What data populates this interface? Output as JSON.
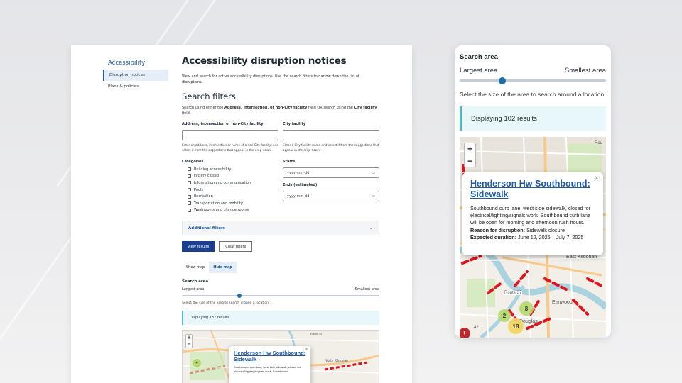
{
  "desktop": {
    "sidebar": {
      "title": "Accessibility",
      "items": [
        {
          "label": "Disruption notices",
          "active": true
        },
        {
          "label": "Plans & policies",
          "active": false
        }
      ]
    },
    "page_title": "Accessibility disruption notices",
    "intro": "View and search for active accessibility disruptions. Use the search filters to narrow down the list of disruptions.",
    "filters_heading": "Search filters",
    "filters_help_pre": "Search using either the ",
    "filters_help_b1": "Address, intersection, or non-City facility",
    "filters_help_mid": " field OR search using the ",
    "filters_help_b2": "City facility",
    "filters_help_post": " field.",
    "address": {
      "label": "Address, intersection or non-City facility",
      "value": "",
      "help": "Enter an address, intersection or name of a non-City facility, and select if from the suggestions that appear in the drop-down."
    },
    "facility": {
      "label": "City facility",
      "value": "",
      "help": "Enter a City facility name and select if from the suggestions that appear in the drop-down."
    },
    "categories": {
      "label": "Categories",
      "items": [
        "Building accessibility",
        "Facility closed",
        "Information and communication",
        "Pools",
        "Recreation",
        "Transportation and mobility",
        "Washrooms and change rooms"
      ]
    },
    "starts": {
      "label": "Starts",
      "placeholder": "yyyy-mm-dd"
    },
    "ends": {
      "label": "Ends (estimated)",
      "placeholder": "yyyy-mm-dd"
    },
    "additional_filters": "Additional filters",
    "view_results": "View results",
    "clear_filters": "Clear filters",
    "show_map": "Show map",
    "hide_map": "Hide map",
    "search_area": {
      "label": "Search area",
      "left": "Largest area",
      "right": "Smallest area",
      "value": 0.29,
      "note": "Select the size of the area to search around a location."
    },
    "results": "Displaying 187 results",
    "map": {
      "popup_title": "Henderson Hw Southbound: Sidewalk",
      "popup_body": "Southbound curb lane, west side sidewalk, closed for electrical/lighting/signals work. Southbound",
      "labels": [
        "Route 42",
        "North Kildonan"
      ],
      "clusters": [
        "4"
      ]
    }
  },
  "mobile": {
    "search_area": {
      "label": "Search area",
      "left": "Largest area",
      "right": "Smallest area",
      "value": 0.29,
      "note": "Select the size of the area to search around a location."
    },
    "results": "Displaying 102 results",
    "map": {
      "zoom_in": "+",
      "zoom_out": "−",
      "close": "×",
      "popup_title": "Henderson Hw Southbound: Sidewalk",
      "popup_body": "Southbound curb lane, west side sidewalk, closed for electrical/lighting/signals work. Southbound curb lane will be open for morning and afternoon rush hours.",
      "reason_label": "Reason for disruption:",
      "reason_value": "Sidewalk closure",
      "duration_label": "Expected duration:",
      "duration_value": "June 12, 2025 – July 7, 2025",
      "labels": [
        "East Kildonan",
        "Route 37",
        "Elmwood",
        "Douglas",
        "Rou",
        "42"
      ],
      "clusters": [
        "2",
        "8",
        "18"
      ]
    }
  },
  "colors": {
    "accent": "#1d5aa8",
    "primary_button": "#1b3f8f",
    "info_bg": "#e8f8fa",
    "info_border": "#4dbcc8",
    "disruption_red": "#e0141e"
  }
}
